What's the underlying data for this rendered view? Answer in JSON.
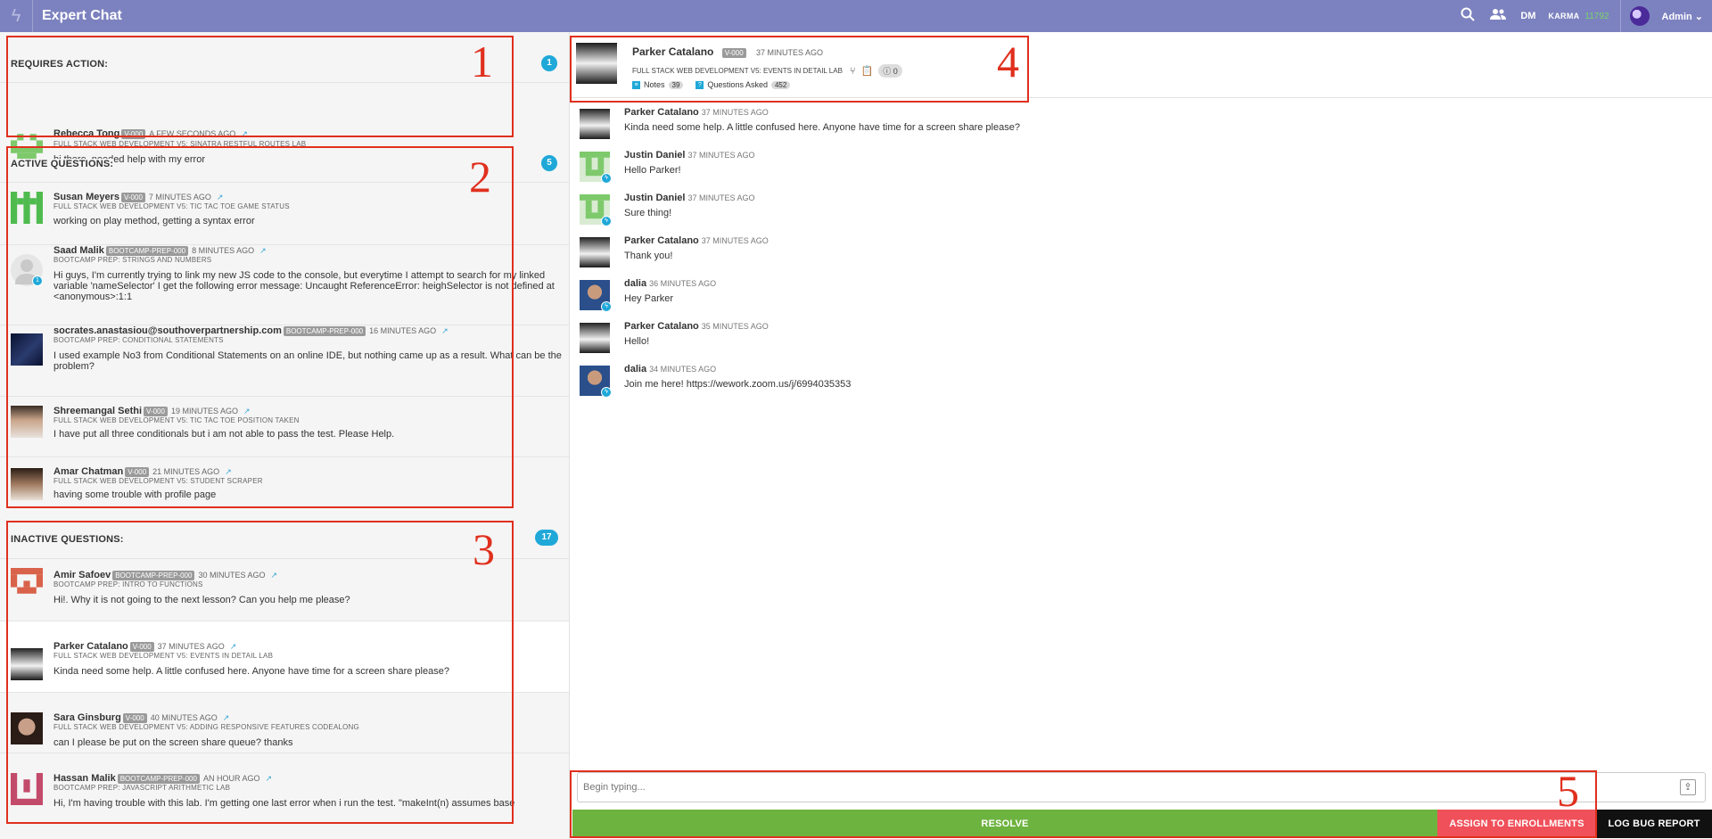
{
  "topbar": {
    "title": "Expert Chat",
    "dm_label": "DM",
    "karma_label": "KARMA",
    "karma_value": "11792",
    "admin_label": "Admin ⌄",
    "icons": [
      "search-icon",
      "people-icon"
    ]
  },
  "sections": {
    "requires_action": {
      "title": "REQUIRES ACTION:",
      "count": "1"
    },
    "active": {
      "title": "ACTIVE QUESTIONS:",
      "count": "5"
    },
    "inactive": {
      "title": "INACTIVE QUESTIONS:",
      "count": "17"
    }
  },
  "requires_action": [
    {
      "name": "Rebecca Tong",
      "tag": "V-000",
      "time": "A FEW SECONDS AGO",
      "course": "FULL STACK WEB DEVELOPMENT V5: SINATRA RESTFUL ROUTES LAB",
      "text": "hi there, needed help with my error"
    }
  ],
  "active": [
    {
      "name": "Susan Meyers",
      "tag": "V-000",
      "time": "7 MINUTES AGO",
      "course": "FULL STACK WEB DEVELOPMENT V5: TIC TAC TOE GAME STATUS",
      "text": "working on play method, getting a syntax error"
    },
    {
      "name": "Saad Malik",
      "tag": "BOOTCAMP-PREP-000",
      "time": "8 MINUTES AGO",
      "course": "BOOTCAMP PREP: STRINGS AND NUMBERS",
      "text": "Hi guys, I'm currently trying to link my new JS code to the console, but everytime I attempt to search for my linked variable 'nameSelector' I get the following error message: Uncaught ReferenceError: heighSelector is not defined at <anonymous>:1:1",
      "avatar_badge": "1"
    },
    {
      "name": "socrates.anastasiou@southoverpartnership.com",
      "tag": "BOOTCAMP-PREP-000",
      "time": "16 MINUTES AGO",
      "course": "BOOTCAMP PREP: CONDITIONAL STATEMENTS",
      "text": "I used example No3 from Conditional Statements on an online IDE, but nothing came up as a result. What can be the problem?"
    },
    {
      "name": "Shreemangal Sethi",
      "tag": "V-000",
      "time": "19 MINUTES AGO",
      "course": "FULL STACK WEB DEVELOPMENT V5: TIC TAC TOE POSITION TAKEN",
      "text": "I have put all three conditionals but i am not able to pass the test. Please Help."
    },
    {
      "name": "Amar Chatman",
      "tag": "V-000",
      "time": "21 MINUTES AGO",
      "course": "FULL STACK WEB DEVELOPMENT V5: STUDENT SCRAPER",
      "text": "having some trouble with profile page"
    }
  ],
  "inactive": [
    {
      "name": "Amir Safoev",
      "tag": "BOOTCAMP-PREP-000",
      "time": "30 MINUTES AGO",
      "course": "BOOTCAMP PREP: INTRO TO FUNCTIONS",
      "text": "Hi!. Why it is not going to the next lesson? Can you help me please?"
    },
    {
      "name": "Parker Catalano",
      "tag": "V-000",
      "time": "37 MINUTES AGO",
      "course": "FULL STACK WEB DEVELOPMENT V5: EVENTS IN DETAIL LAB",
      "text": "Kinda need some help. A little confused here. Anyone have time for a screen share please?"
    },
    {
      "name": "Sara Ginsburg",
      "tag": "V-000",
      "time": "40 MINUTES AGO",
      "course": "FULL STACK WEB DEVELOPMENT V5: ADDING RESPONSIVE FEATURES CODEALONG",
      "text": "can I please be put on the screen share queue? thanks"
    },
    {
      "name": "Hassan Malik",
      "tag": "BOOTCAMP-PREP-000",
      "time": "AN HOUR AGO",
      "course": "BOOTCAMP PREP: JAVASCRIPT ARITHMETIC LAB",
      "text": "Hi, I'm having trouble with this lab. I'm getting one last error when i run the test. \"makeInt(n) assumes base"
    }
  ],
  "profile": {
    "name": "Parker Catalano",
    "tag": "V-000",
    "time": "37 MINUTES AGO",
    "course": "FULL STACK WEB DEVELOPMENT V5: EVENTS IN DETAIL LAB",
    "warning_count": "0",
    "notes_label": "Notes",
    "notes_count": "39",
    "questions_label": "Questions Asked",
    "questions_count": "452"
  },
  "messages": [
    {
      "name": "Parker Catalano",
      "time": "37 MINUTES AGO",
      "text": "Kinda need some help. A little confused here. Anyone have time for a screen share please?"
    },
    {
      "name": "Justin Daniel",
      "time": "37 MINUTES AGO",
      "text": "Hello Parker!"
    },
    {
      "name": "Justin Daniel",
      "time": "37 MINUTES AGO",
      "text": "Sure thing!"
    },
    {
      "name": "Parker Catalano",
      "time": "37 MINUTES AGO",
      "text": "Thank you!"
    },
    {
      "name": "dalia",
      "time": "36 MINUTES AGO",
      "text": "Hey Parker"
    },
    {
      "name": "Parker Catalano",
      "time": "35 MINUTES AGO",
      "text": "Hello!"
    },
    {
      "name": "dalia",
      "time": "34 MINUTES AGO",
      "text": "Join me here! https://wework.zoom.us/j/6994035353"
    }
  ],
  "composer": {
    "placeholder": "Begin typing..."
  },
  "actions": {
    "resolve": "RESOLVE",
    "assign": "ASSIGN TO ENROLLMENTS",
    "log_bug": "LOG BUG REPORT"
  },
  "annotations": [
    "1",
    "2",
    "3",
    "4",
    "5"
  ],
  "colors": {
    "topbar": "#7c82bf",
    "badge": "#1fa8d8",
    "resolve": "#6db33f",
    "assign": "#f0505a",
    "log_bug": "#111111",
    "annotation": "#e0301e"
  }
}
